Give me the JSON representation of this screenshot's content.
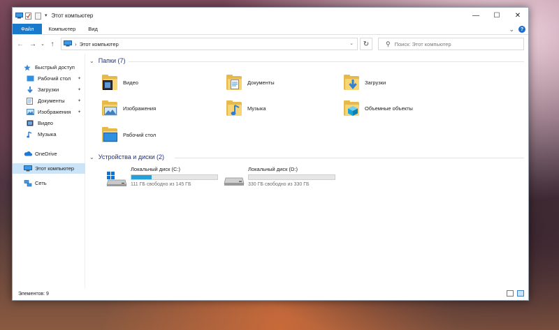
{
  "window": {
    "title": "Этот компьютер",
    "minimize_glyph": "—",
    "maximize_glyph": "☐",
    "close_glyph": "✕"
  },
  "ribbon": {
    "tabs": [
      "Файл",
      "Компьютер",
      "Вид"
    ],
    "expand_glyph": "⌄",
    "help_glyph": "?"
  },
  "nav": {
    "back_glyph": "←",
    "forward_glyph": "→",
    "recent_glyph": "⌄",
    "up_glyph": "↑",
    "path": "Этот компьютер",
    "path_separator": "›",
    "dropdown_glyph": "⌄",
    "refresh_glyph": "↻",
    "search_placeholder": "Поиск: Этот компьютер",
    "search_icon": "⚲"
  },
  "sidebar": {
    "items": [
      {
        "label": "Быстрый доступ",
        "icon": "star-icon",
        "pinned": false
      },
      {
        "label": "Рабочий стол",
        "icon": "desktop-icon",
        "pinned": true
      },
      {
        "label": "Загрузки",
        "icon": "download-icon",
        "pinned": true
      },
      {
        "label": "Документы",
        "icon": "documents-icon",
        "pinned": true
      },
      {
        "label": "Изображения",
        "icon": "pictures-icon",
        "pinned": true
      },
      {
        "label": "Видео",
        "icon": "video-icon",
        "pinned": false
      },
      {
        "label": "Музыка",
        "icon": "music-icon",
        "pinned": false
      },
      {
        "label": "OneDrive",
        "icon": "onedrive-icon",
        "pinned": false
      },
      {
        "label": "Этот компьютер",
        "icon": "computer-icon",
        "pinned": false,
        "selected": true
      },
      {
        "label": "Сеть",
        "icon": "network-icon",
        "pinned": false
      }
    ],
    "pin_glyph": "📌"
  },
  "main": {
    "folders_header": "Папки (7)",
    "devices_header": "Устройства и диски (2)",
    "folders": [
      {
        "label": "Видео",
        "icon": "video-folder-icon"
      },
      {
        "label": "Документы",
        "icon": "documents-folder-icon"
      },
      {
        "label": "Загрузки",
        "icon": "downloads-folder-icon"
      },
      {
        "label": "Изображения",
        "icon": "pictures-folder-icon"
      },
      {
        "label": "Музыка",
        "icon": "music-folder-icon"
      },
      {
        "label": "Объемные объекты",
        "icon": "3d-objects-folder-icon"
      },
      {
        "label": "Рабочий стол",
        "icon": "desktop-folder-icon"
      }
    ],
    "drives": [
      {
        "label": "Локальный диск (C:)",
        "free": "111 ГБ свободно из 145 ГБ",
        "used_fraction": 0.234,
        "icon": "system-drive-icon"
      },
      {
        "label": "Локальный диск (D:)",
        "free": "330 ГБ свободно из 330 ГБ",
        "used_fraction": 0.0,
        "icon": "drive-icon"
      }
    ]
  },
  "status": {
    "item_count": "Элементов: 9"
  },
  "colors": {
    "accent": "#1979ca",
    "header_text": "#1e3287",
    "drive_bar": "#26a0da",
    "selected_bg": "#cce4f7"
  }
}
